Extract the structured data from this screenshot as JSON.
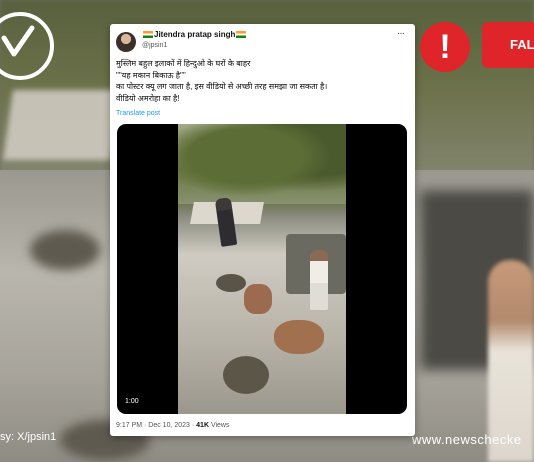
{
  "overlay": {
    "false_label": "FAL",
    "alert_symbol": "!",
    "courtesy": "sy: X/jpsin1",
    "site": "www.newschecke"
  },
  "tweet": {
    "name": "Jitendra pratap singh",
    "handle": "@jpsin1",
    "more": "···",
    "lines": [
      "मुस्लिम बहुल इलाकों में हिन्दुओ के घरों के बाहर",
      "\"\"यह मकान बिकाऊ है\"\"",
      "का पोस्टर क्यू लग जाता है, इस वीडियो से अच्छी तरह समझा जा सकता है।",
      "वीडियो अमरोहा का है!"
    ],
    "translate": "Translate post",
    "video_duration": "1:00",
    "time": "9:17 PM · Dec 10, 2023 · ",
    "views_count": "41K",
    "views_label": " Views"
  },
  "colors": {
    "alert_red": "#e0252a",
    "link_blue": "#1d9bf0"
  }
}
